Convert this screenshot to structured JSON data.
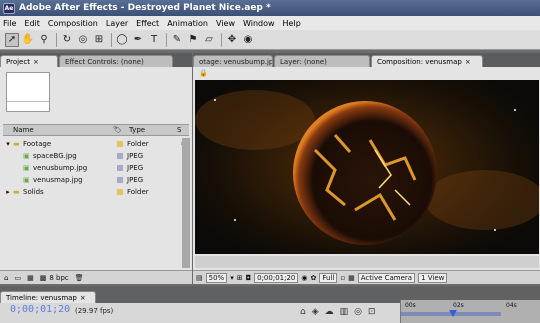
{
  "window": {
    "title": "Adobe After Effects - Destroyed Planet Nice.aep *"
  },
  "menu": [
    "File",
    "Edit",
    "Composition",
    "Layer",
    "Effect",
    "Animation",
    "View",
    "Window",
    "Help"
  ],
  "left_tabs": {
    "project": "Project",
    "effect_controls": "Effect Controls: (none)"
  },
  "right_tabs": {
    "footage": "otage: venusbump.jpg",
    "layer": "Layer: (none)",
    "composition": "Composition: venusmap"
  },
  "project": {
    "columns": {
      "name": "Name",
      "type": "Type",
      "extra": "S"
    },
    "items": [
      {
        "name": "Footage",
        "type": "Folder",
        "color": "#e8c45a"
      },
      {
        "name": "spaceBG.jpg",
        "type": "JPEG",
        "color": "#a8a8c8"
      },
      {
        "name": "venusbump.jpg",
        "type": "JPEG",
        "color": "#a8a8c8"
      },
      {
        "name": "venusmap.jpg",
        "type": "JPEG",
        "color": "#a8a8c8"
      },
      {
        "name": "Solids",
        "type": "Folder",
        "color": "#e8c45a"
      }
    ],
    "bpc": "8 bpc"
  },
  "viewer": {
    "zoom": "50%",
    "timecode": "0;00;01;20",
    "resolution": "Full",
    "camera": "Active Camera",
    "views": "1 View"
  },
  "timeline": {
    "tab": "Timeline: venusmap",
    "timecode": "0;00;01;20",
    "fps": "(29.97 fps)",
    "ruler": [
      "00s",
      "02s",
      "04s"
    ]
  }
}
